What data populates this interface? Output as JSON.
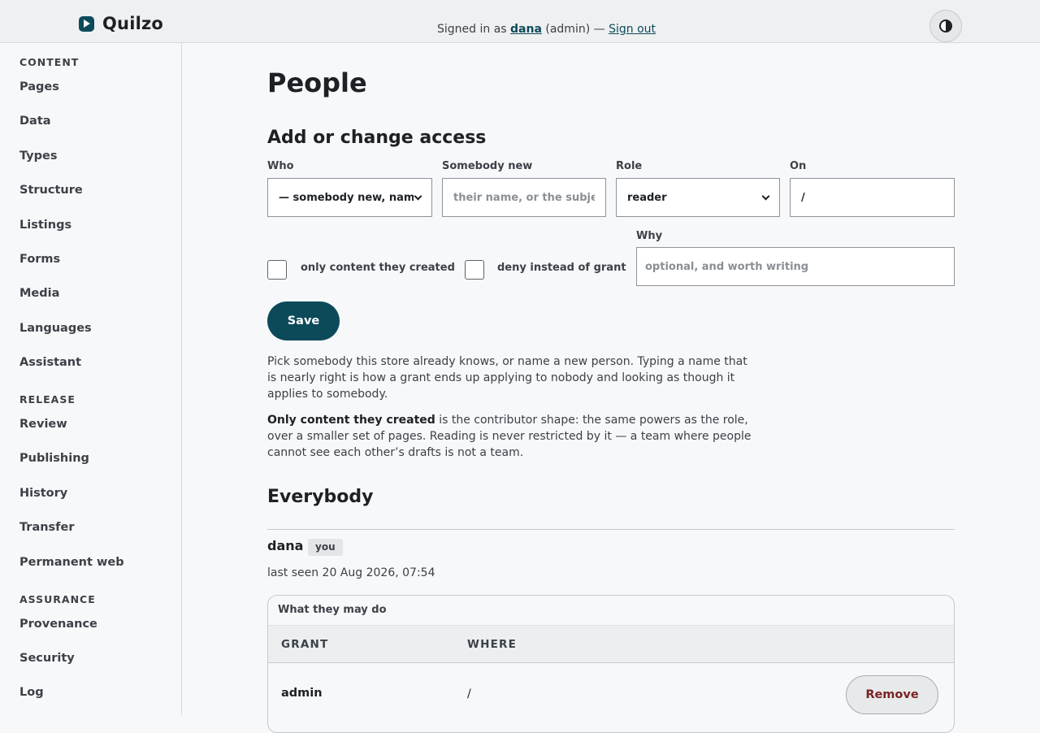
{
  "app": {
    "name": "Quilzo"
  },
  "session": {
    "prefix": "Signed in as",
    "user": "dana",
    "role_suffix": "(admin) —",
    "sign_out": "Sign out"
  },
  "sidebar": {
    "sections": [
      {
        "title": "CONTENT",
        "items": [
          "Pages",
          "Data",
          "Types",
          "Structure",
          "Listings",
          "Forms",
          "Media",
          "Languages",
          "Assistant"
        ]
      },
      {
        "title": "RELEASE",
        "items": [
          "Review",
          "Publishing",
          "History",
          "Transfer",
          "Permanent web"
        ]
      },
      {
        "title": "ASSURANCE",
        "items": [
          "Provenance",
          "Security",
          "Log"
        ]
      }
    ]
  },
  "page": {
    "title": "People"
  },
  "access_form": {
    "heading": "Add or change access",
    "who": {
      "label": "Who",
      "value": "— somebody new, name them"
    },
    "somebody_new": {
      "label": "Somebody new",
      "placeholder": "their name, or the subject"
    },
    "role": {
      "label": "Role",
      "value": "reader"
    },
    "on": {
      "label": "On",
      "value": "/"
    },
    "only_created": {
      "label": "only content they created",
      "checked": false
    },
    "deny": {
      "label": "deny instead of grant",
      "checked": false
    },
    "why": {
      "label": "Why",
      "placeholder": "optional, and worth writing"
    },
    "save_label": "Save"
  },
  "help": {
    "p1": "Pick somebody this store already knows, or name a new person. Typing a name that is nearly right is how a grant ends up applying to nobody and looking as though it applies to somebody.",
    "p2_strong": "Only content they created",
    "p2_rest": " is the contributor shape: the same powers as the role, over a smaller set of pages. Reading is never restricted by it — a team where people cannot see each other’s drafts is not a team."
  },
  "everybody": {
    "heading": "Everybody",
    "people": [
      {
        "name": "dana",
        "badge": "you",
        "last_seen": "last seen 20 Aug 2026, 07:54",
        "grants_caption": "What they may do",
        "columns": [
          "GRANT",
          "WHERE"
        ],
        "grants": [
          {
            "grant": "admin",
            "where": "/",
            "action": "Remove"
          }
        ]
      }
    ]
  }
}
